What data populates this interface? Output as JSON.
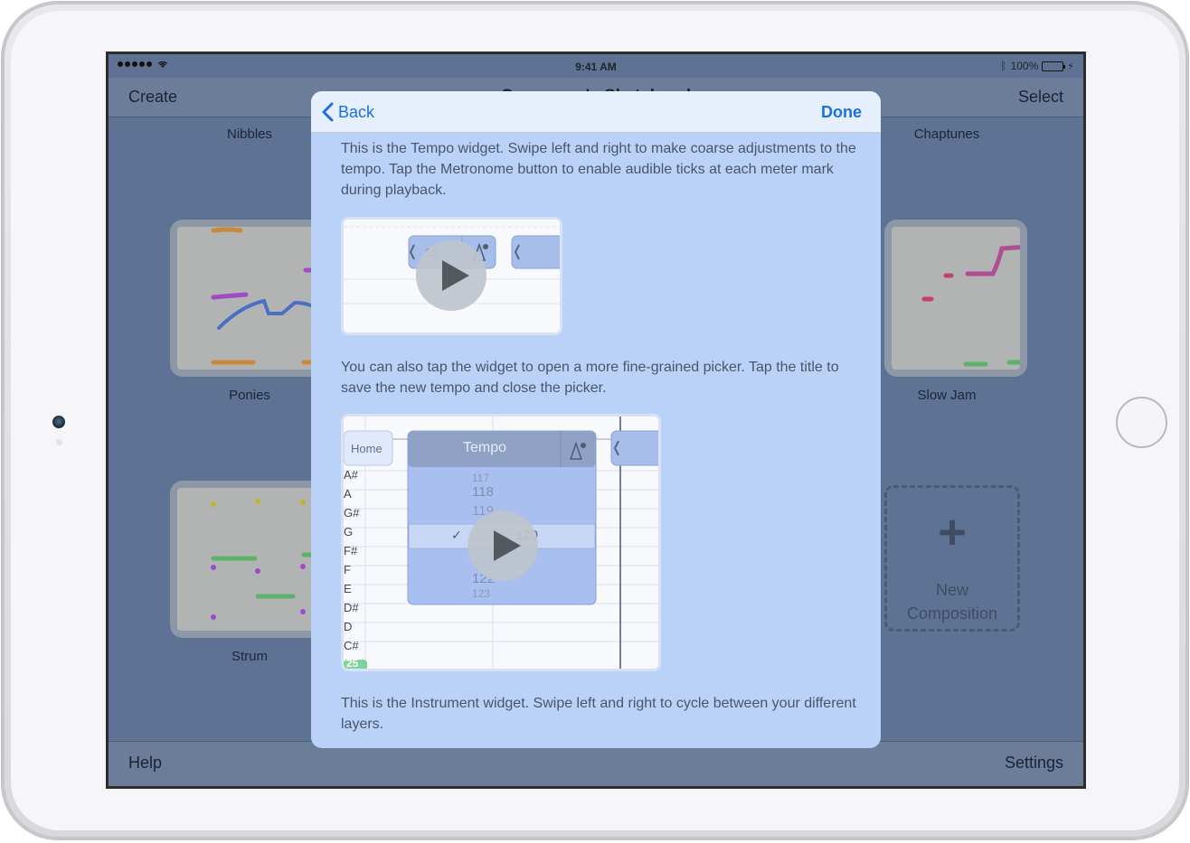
{
  "status_bar": {
    "time": "9:41 AM",
    "battery": "100%"
  },
  "nav": {
    "left_label": "Create",
    "title": "Composer's Sketchpad",
    "right_label": "Select"
  },
  "tiles": {
    "nibbles": "Nibbles",
    "chaptunes": "Chaptunes",
    "ponies": "Ponies",
    "slow_jam": "Slow Jam",
    "strum": "Strum",
    "new_composition_line1": "New",
    "new_composition_line2": "Composition"
  },
  "toolbar": {
    "help_label": "Help",
    "settings_label": "Settings"
  },
  "modal": {
    "back_label": "Back",
    "done_label": "Done",
    "paragraph1": "This is the Tempo widget. Swipe left and right to make coarse adjustments to the tempo. Tap the Metronome button to enable audible ticks at each meter mark during playback.",
    "paragraph2": "You can also tap the widget to open a more fine-grained picker. Tap the title to save the new tempo and close the picker.",
    "paragraph3": "This is the Instrument widget. Swipe left and right to cycle between your different layers.",
    "clip2": {
      "home_label": "Home",
      "tempo_title": "Tempo",
      "picker_values": [
        "117",
        "118",
        "119",
        "120",
        "121",
        "122",
        "123"
      ],
      "check": "✓",
      "note_labels": [
        "A#",
        "A",
        "G#",
        "G",
        "F#",
        "F",
        "E",
        "D#",
        "D",
        "C#"
      ],
      "measure_badge": "25"
    },
    "clip1": {
      "tempo_partial": "12"
    }
  },
  "colors": {
    "accent": "#1b6fe0",
    "modal_bg": "#bad2f8",
    "dim_bg": "#5e7394"
  }
}
